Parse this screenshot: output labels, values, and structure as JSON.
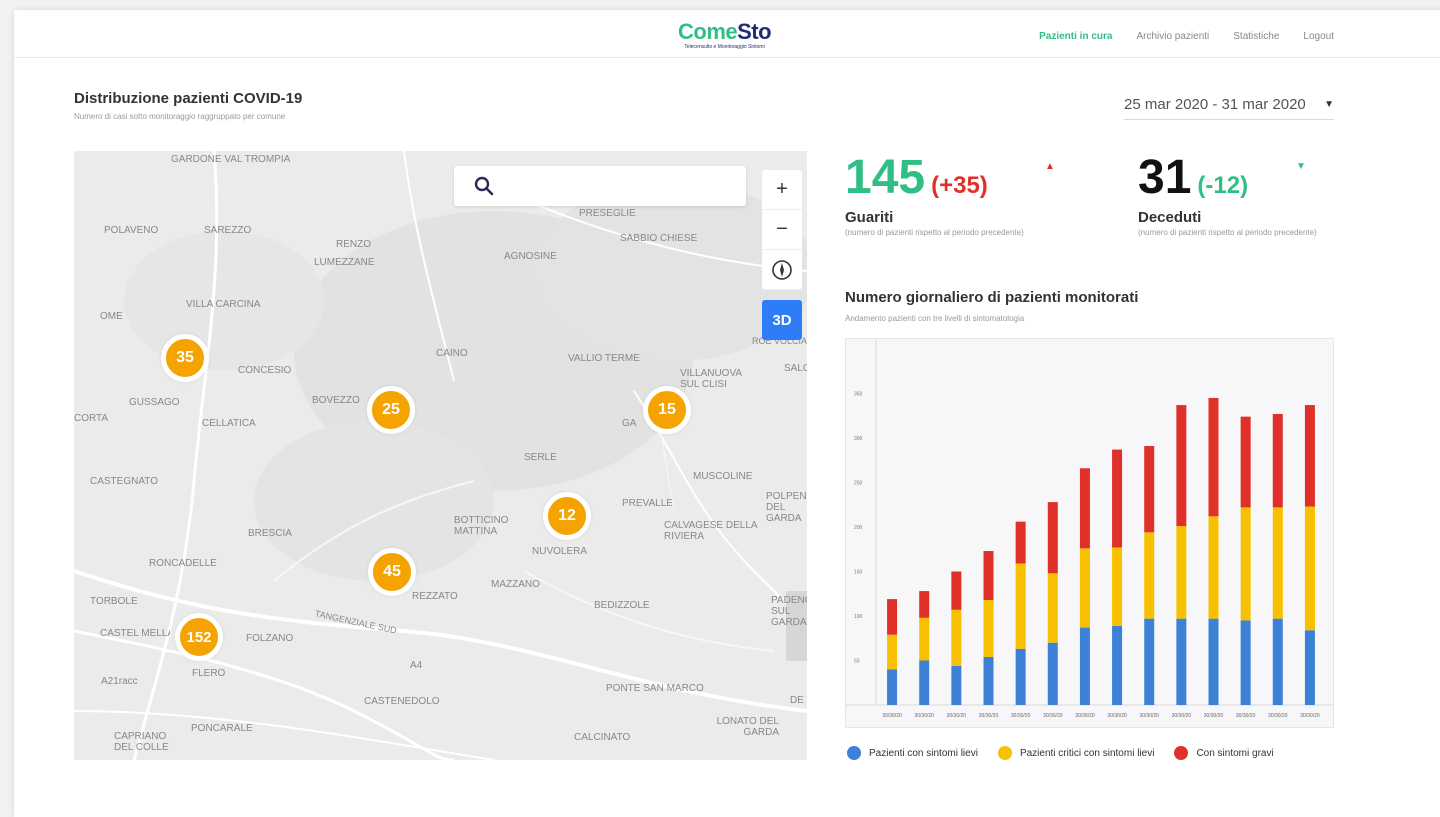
{
  "header": {
    "logo_come": "Come",
    "logo_sto": "Sto",
    "logo_subtitle": "Telecensulto e Monitoraggio Sintomi",
    "nav": [
      {
        "label": "Pazienti in cura",
        "active": true
      },
      {
        "label": "Archivio pazienti",
        "active": false
      },
      {
        "label": "Statistiche",
        "active": false
      },
      {
        "label": "Logout",
        "active": false
      }
    ]
  },
  "page": {
    "title": "Distribuzione pazienti COVID-19",
    "subtitle": "Numero di casi sotto monitoraggio raggruppato per comune",
    "date_range": "25 mar 2020 - 31 mar 2020"
  },
  "map": {
    "search_placeholder": "",
    "controls": {
      "zoom_in": "+",
      "zoom_out": "−",
      "mode_3d": "3D"
    },
    "places": [
      "GARDONE VAL TROMPIA",
      "POLAVENO",
      "SAREZZO",
      "RENZO",
      "LUMEZZANE",
      "PRESEGLIE",
      "SABBIO CHIESE",
      "AGNOSINE",
      "VILLA CARCINA",
      "OME",
      "CAINO",
      "VALLIO TERME",
      "VILLANUOVA SUL CLISI",
      "CONCESIO",
      "GUSSAGO",
      "BOVEZZO",
      "CELLATICA",
      "CORTA",
      "SERLE",
      "MUSCOLINE",
      "CASTEGNATO",
      "PREVALLE",
      "POLPENAZZE DEL GARDA",
      "BOTTICINO MATTINA",
      "NUVOLERA",
      "CALVAGESE DELLA RIVIERA",
      "BRESCIA",
      "RONCADELLE",
      "MAZZANO",
      "REZZATO",
      "TORBOLE",
      "BEDIZZOLE",
      "PADENGHE SUL GARDA",
      "CASTEL MELLA",
      "FOLZANO",
      "TANGENZIALE SUD",
      "A4",
      "FLERO",
      "PONTE SAN MARCO",
      "A21racc",
      "CASTENEDOLO",
      "CAPRIANO DEL COLLE",
      "PONCARALE",
      "LONATO DEL GARDA",
      "CALCINATO",
      "SALO",
      "ROÈ VOLCIANO",
      "GA",
      "DE"
    ],
    "clusters": [
      35,
      25,
      15,
      12,
      45,
      152
    ]
  },
  "stats": {
    "recovered": {
      "value": "145",
      "delta": "(+35)",
      "label": "Guariti",
      "note": "(numero di pazienti rispetto al periodo precedente)",
      "trend": "up"
    },
    "deceased": {
      "value": "31",
      "delta": "(-12)",
      "label": "Deceduti",
      "note": "(numero di pazienti rispetto al periodo precedente)",
      "trend": "down"
    }
  },
  "chart": {
    "title": "Numero giornaliero di pazienti monitorati",
    "subtitle": "Andamento pazienti con tre livelli di sintomatologia"
  },
  "colors": {
    "accent_green": "#2fbf85",
    "navy": "#1f2e73",
    "cluster_orange": "#f5a300",
    "red": "#e0302a",
    "blue": "#3b82d6",
    "yellow": "#f7c000",
    "map_3d_blue": "#2e7cf6"
  },
  "chart_data": {
    "type": "bar",
    "stacked": true,
    "categories": [
      "30/30/20",
      "30/30/20",
      "30/30/20",
      "30/30/20",
      "30/30/20",
      "30/30/20",
      "30/30/20",
      "30/30/20",
      "30/30/20",
      "30/30/20",
      "30/30/20",
      "30/30/20",
      "30/30/20",
      "30/30/20"
    ],
    "series": [
      {
        "name": "Pazienti con sintomi lievi",
        "color": "#3b82d6",
        "values": [
          40,
          50,
          44,
          54,
          63,
          70,
          87,
          89,
          97,
          97,
          97,
          95,
          97,
          84
        ]
      },
      {
        "name": "Pazienti critici con sintomi lievi",
        "color": "#f7c000",
        "values": [
          39,
          48,
          63,
          64,
          96,
          78,
          89,
          88,
          97,
          104,
          115,
          127,
          125,
          139
        ]
      },
      {
        "name": "Con sintomi gravi",
        "color": "#e0302a",
        "values": [
          40,
          30,
          43,
          55,
          47,
          80,
          90,
          110,
          97,
          136,
          133,
          102,
          105,
          114
        ]
      }
    ],
    "yticks": [
      50,
      100,
      150,
      200,
      250,
      300,
      350
    ],
    "ylim": [
      0,
      400
    ],
    "grid": false,
    "legend_position": "bottom"
  }
}
